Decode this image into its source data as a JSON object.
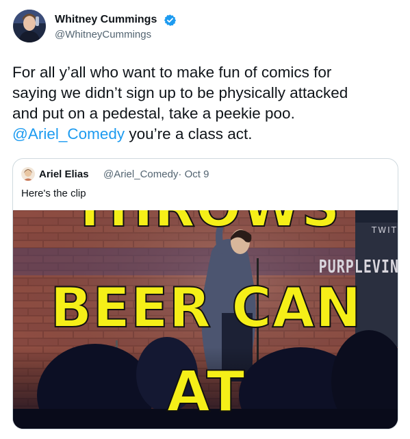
{
  "author": {
    "name": "Whitney Cummings",
    "handle": "@WhitneyCummings",
    "verified": true,
    "avatar_icon": "profile-photo"
  },
  "tweet": {
    "line_1": "For all y’all who want to make fun of comics for",
    "line_2": "saying we didn’t sign up to be physically attacked",
    "line_3": "and put on a pedestal, take a peekie poo.",
    "mention": "@Ariel_Comedy",
    "line_4_rest": " you’re a class act."
  },
  "quoted_tweet": {
    "name": "Ariel Elias",
    "handle_date": "@Ariel_Comedy· Oct 9",
    "text": "Here's the clip",
    "media": {
      "caption_1": "THROWS",
      "caption_2": "BEER CAN",
      "caption_3": "AT",
      "sign_top": "TWIT",
      "sign_mid": "PURPLEVIN"
    }
  },
  "colors": {
    "link": "#1d9bf0",
    "verified": "#1d9bf0",
    "caption": "#f5ef18",
    "secondary_text": "#536471",
    "border": "#cfd9de"
  }
}
